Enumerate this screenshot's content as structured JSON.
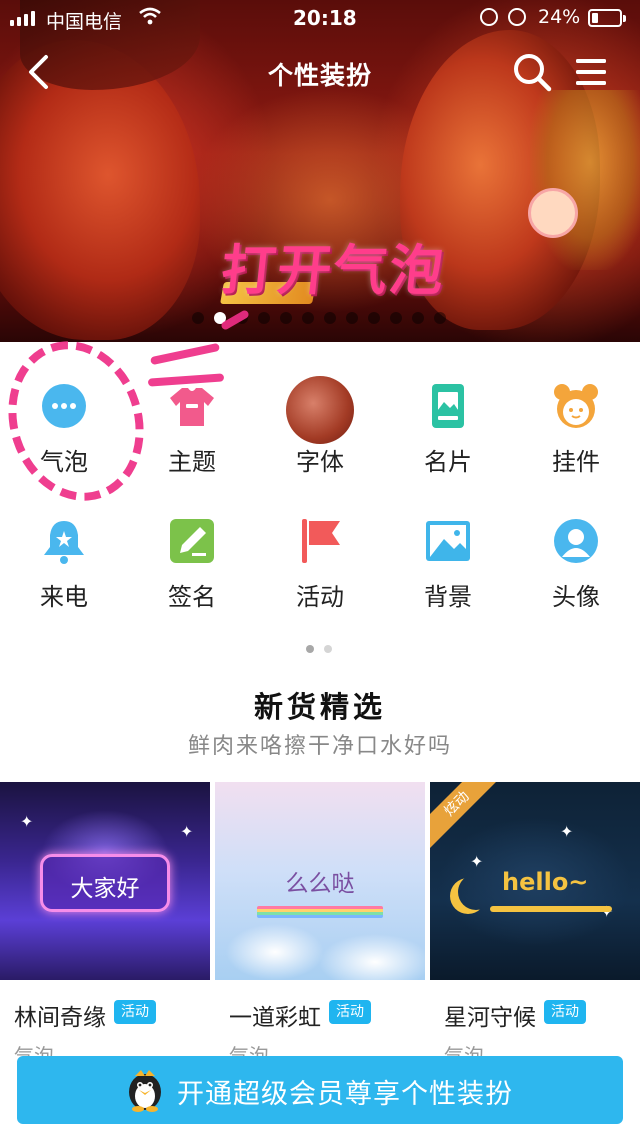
{
  "status_bar": {
    "carrier": "中国电信",
    "time": "20:18",
    "battery_percent": "24%",
    "battery_level": 0.24
  },
  "nav": {
    "title": "个性装扮",
    "back_icon": "chevron-left-icon",
    "search_icon": "search-icon",
    "menu_icon": "menu-icon"
  },
  "banner": {
    "slogan": "打开气泡",
    "slide_count": 12,
    "active_slide": 1
  },
  "grid": {
    "items": [
      {
        "label": "气泡",
        "icon": "bubble-icon",
        "color": "#4ab7ee"
      },
      {
        "label": "主题",
        "icon": "shirt-icon",
        "color": "#f25a8c"
      },
      {
        "label": "字体",
        "icon": "font-avatar",
        "color": "#b3543a"
      },
      {
        "label": "名片",
        "icon": "card-icon",
        "color": "#2bc2a3"
      },
      {
        "label": "挂件",
        "icon": "pendant-face-icon",
        "color": "#f4a53b"
      },
      {
        "label": "来电",
        "icon": "bell-icon",
        "color": "#4ab7ee"
      },
      {
        "label": "签名",
        "icon": "edit-icon",
        "color": "#7cc24a"
      },
      {
        "label": "活动",
        "icon": "flag-icon",
        "color": "#f25a5a"
      },
      {
        "label": "背景",
        "icon": "picture-icon",
        "color": "#3fb5ea"
      },
      {
        "label": "头像",
        "icon": "avatar-icon",
        "color": "#4ab7ee"
      }
    ],
    "page_count": 2,
    "active_page": 1
  },
  "section": {
    "title": "新货精选",
    "subtitle": "鲜肉来咯擦干净口水好吗"
  },
  "cards": [
    {
      "name": "林间奇缘",
      "badge": "活动",
      "type": "气泡",
      "preview_text": "大家好"
    },
    {
      "name": "一道彩虹",
      "badge": "活动",
      "type": "气泡",
      "preview_text": "么么哒"
    },
    {
      "name": "星河守候",
      "badge": "活动",
      "type": "气泡",
      "preview_text": "hello~",
      "corner_tag": "炫动"
    }
  ],
  "cta": {
    "label": "开通超级会员尊享个性装扮",
    "icon": "qq-penguin-icon",
    "color": "#2eb7ee"
  }
}
